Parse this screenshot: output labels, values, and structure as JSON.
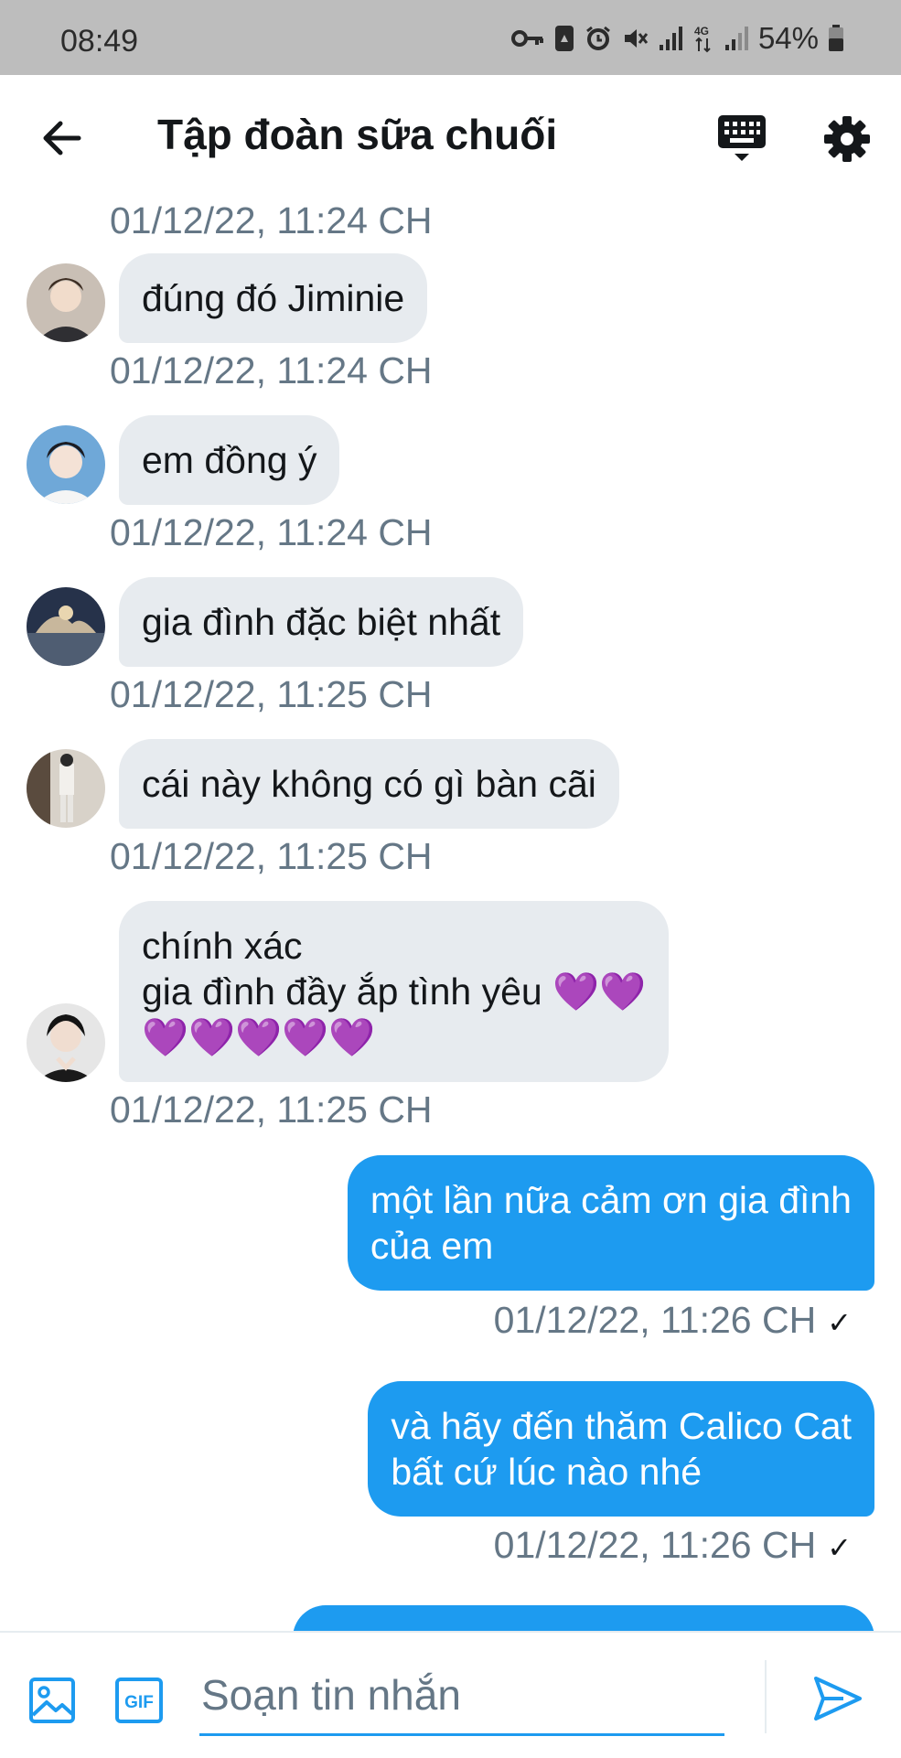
{
  "status_bar": {
    "time": "08:49",
    "network": "4G",
    "battery": "54%",
    "icons": [
      "key-icon",
      "recycle-icon",
      "alarm-icon",
      "mute-icon",
      "signal-icon",
      "data-icon",
      "signal-icon",
      "battery-icon"
    ]
  },
  "header": {
    "title": "Tập đoàn sữa chuối",
    "icons": [
      "back-arrow-icon",
      "keyboard-icon",
      "gear-icon"
    ]
  },
  "messages": [
    {
      "direction": "in",
      "timestamp": "01/12/22, 11:24 CH"
    },
    {
      "direction": "in",
      "text": "đúng đó Jiminie",
      "timestamp": "01/12/22, 11:24 CH"
    },
    {
      "direction": "in",
      "text": "em đồng ý",
      "timestamp": "01/12/22, 11:24 CH"
    },
    {
      "direction": "in",
      "text": "gia đình đặc biệt nhất",
      "timestamp": "01/12/22, 11:25 CH"
    },
    {
      "direction": "in",
      "text": "cái này không có gì bàn cãi",
      "timestamp": "01/12/22, 11:25 CH"
    },
    {
      "direction": "in",
      "text": "chính xác\ngia đình đầy ắp tình yêu 💜💜\n💜💜💜💜💜",
      "timestamp": "01/12/22, 11:25 CH"
    },
    {
      "direction": "out",
      "text": "một lần nữa cảm ơn gia đình\ncủa em",
      "timestamp": "01/12/22, 11:26 CH",
      "status": "✓"
    },
    {
      "direction": "out",
      "text": "và hãy đến thăm Calico Cat\nbất cứ lúc nào nhé",
      "timestamp": "01/12/22, 11:26 CH",
      "status": "✓"
    }
  ],
  "composer": {
    "placeholder": "Soạn tin nhắn",
    "gif_label": "GIF"
  },
  "colors": {
    "accent": "#1d9bf0",
    "incoming_bubble": "#e7ebef",
    "timestamp": "#657786",
    "status_bar": "#bdbdbd"
  }
}
